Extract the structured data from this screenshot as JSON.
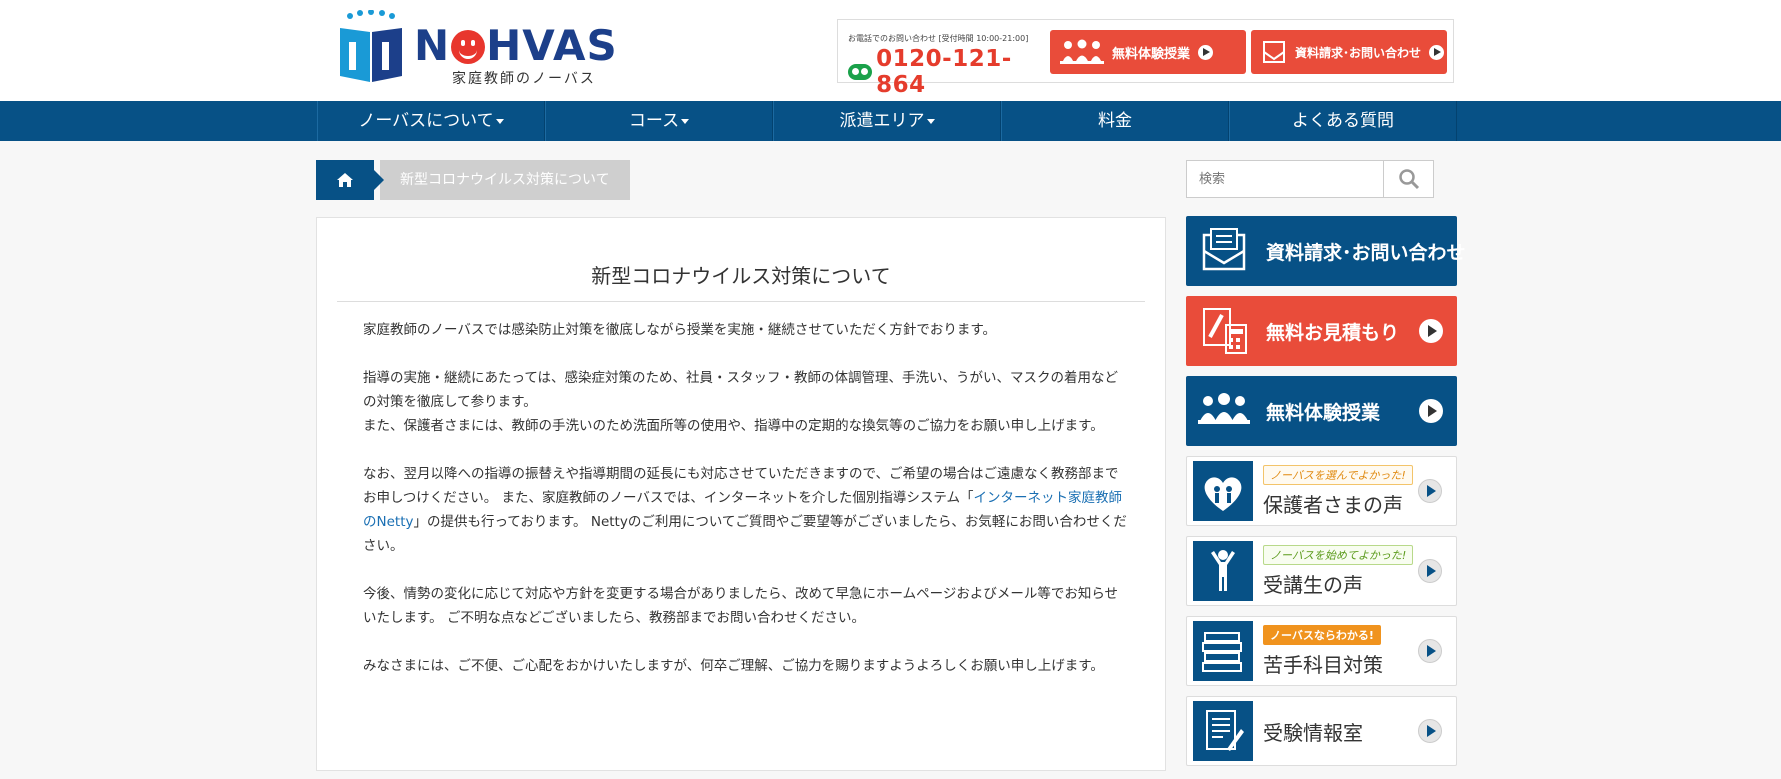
{
  "header": {
    "logo_word_left": "N",
    "logo_word_right": "HVAS",
    "logo_sub": "家庭教師のノーバス",
    "phone_caption": "お電話でのお問い合わせ [受付時間 10:00-21:00]",
    "phone_number": "0120-121-864",
    "btn_trial": "無料体験授業",
    "btn_docs": "資料請求･お問い合わせ"
  },
  "nav": {
    "items": [
      "ノーバスについて",
      "コース",
      "派遣エリア",
      "料金",
      "よくある質問"
    ]
  },
  "breadcrumb": {
    "current": "新型コロナウイルス対策について"
  },
  "main": {
    "title": "新型コロナウイルス対策について",
    "p1": "家庭教師のノーバスでは感染防止対策を徹底しながら授業を実施・継続させていただく方針でおります。",
    "p2a": "指導の実施・継続にあたっては、感染症対策のため、社員・スタッフ・教師の体調管理、手洗い、うがい、マスクの着用などの対策を徹底して参ります。",
    "p2b": "また、保護者さまには、教師の手洗いのため洗面所等の使用や、指導中の定期的な換気等のご協力をお願い申し上げます。",
    "p3a": "なお、翌月以降への指導の振替えや指導期間の延長にも対応させていただきますので、ご希望の場合はご遠慮なく教務部までお申しつけください。 また、家庭教師のノーバスでは、インターネットを介した個別指導システム「",
    "p3_link": "インターネット家庭教師のNetty",
    "p3b": "」の提供も行っております。 Nettyのご利用についてご質問やご要望等がございましたら、お気軽にお問い合わせください。",
    "p4": "今後、情勢の変化に応じて対応や方針を変更する場合がありましたら、改めて早急にホームページおよびメール等でお知らせいたします。 ご不明な点などございましたら、教務部までお問い合わせください。",
    "p5": "みなさまには、ご不便、ご心配をおかけいたしますが、何卒ご理解、ご協力を賜りますようよろしくお願い申し上げます。"
  },
  "sidebar": {
    "search_placeholder": "検索",
    "banner_docs": "資料請求･お問い合わせ",
    "banner_estimate": "無料お見積もり",
    "banner_trial": "無料体験授業",
    "parents_tag": "ノーバスを選んでよかった!",
    "parents_label": "保護者さまの声",
    "students_tag": "ノーバスを始めてよかった!",
    "students_label": "受講生の声",
    "weak_tag": "ノーバスならわかる!",
    "weak_label": "苦手科目対策",
    "exam_label": "受験情報室"
  },
  "colors": {
    "brand_blue": "#075186",
    "accent_red": "#e94c3a",
    "link_blue": "#1a6fb3"
  }
}
